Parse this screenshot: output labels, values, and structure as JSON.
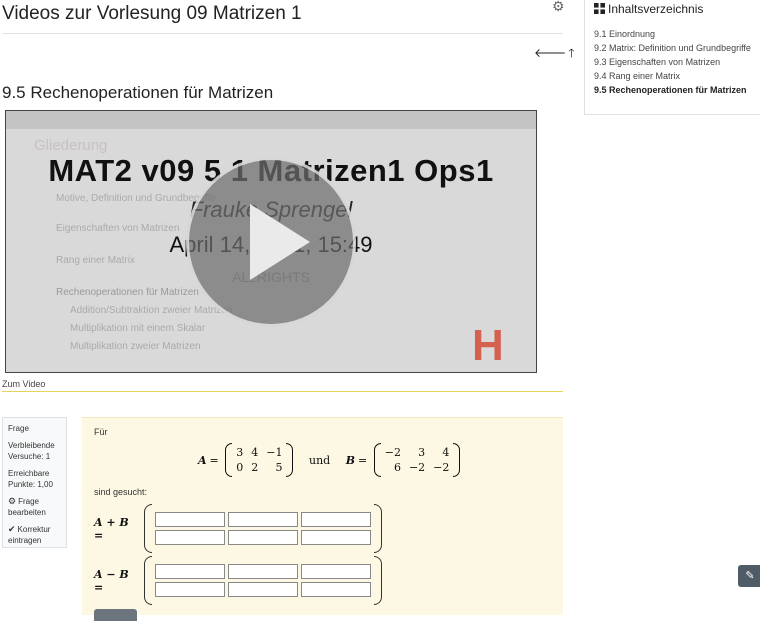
{
  "page": {
    "title": "Videos zur Vorlesung 09 Matrizen 1",
    "section_title": "9.5 Rechenoperationen für Matrizen"
  },
  "video": {
    "title": "MAT2 v09 5 1 Matrizen1 Ops1",
    "author": "Frauke Sprengel",
    "date": "April 14, 2021, 15:49",
    "rights": "ALLRIGHTS",
    "link_label": "Zum Video",
    "slide": {
      "heading": "Gliederung",
      "items": [
        "Motive, Definition und Grundbegriffe",
        "Eigenschaften von Matrizen",
        "Rang einer Matrix",
        "Rechenoperationen für Matrizen",
        "Addition/Subtraktion zweier Matrizen",
        "Multiplikation mit einem Skalar",
        "Multiplikation zweier Matrizen"
      ],
      "corner_letter": "H"
    }
  },
  "question_info": {
    "label": "Frage",
    "remaining_label": "Verbleibende Versuche: 1",
    "points_label": "Erreichbare Punkte: 1,00",
    "edit_label": "Frage bearbeiten",
    "correction_label": "Korrektur eintragen"
  },
  "question": {
    "intro": "Für",
    "and_word": "und",
    "asked": "sind gesucht:",
    "matrix_a": {
      "name": "A",
      "rows": [
        [
          "3",
          "4",
          "−1"
        ],
        [
          "0",
          "2",
          "5"
        ]
      ]
    },
    "matrix_b": {
      "name": "B",
      "rows": [
        [
          "−2",
          "3",
          "4"
        ],
        [
          "6",
          "−2",
          "−2"
        ]
      ]
    },
    "sum_label": "A + B =",
    "diff_label": "A − B ="
  },
  "toc": {
    "title": "Inhaltsverzeichnis",
    "items": [
      "9.1 Einordnung",
      "9.2 Matrix: Definition und Grundbegriffe",
      "9.3 Eigenschaften von Matrizen",
      "9.4 Rang einer Matrix",
      "9.5 Rechenoperationen für Matrizen"
    ]
  },
  "icons": {
    "gear": "gear-icon",
    "back": "arrow-left-icon",
    "up": "arrow-up-icon",
    "play": "play-icon",
    "toc": "grid-icon",
    "pencil": "pencil-icon"
  }
}
